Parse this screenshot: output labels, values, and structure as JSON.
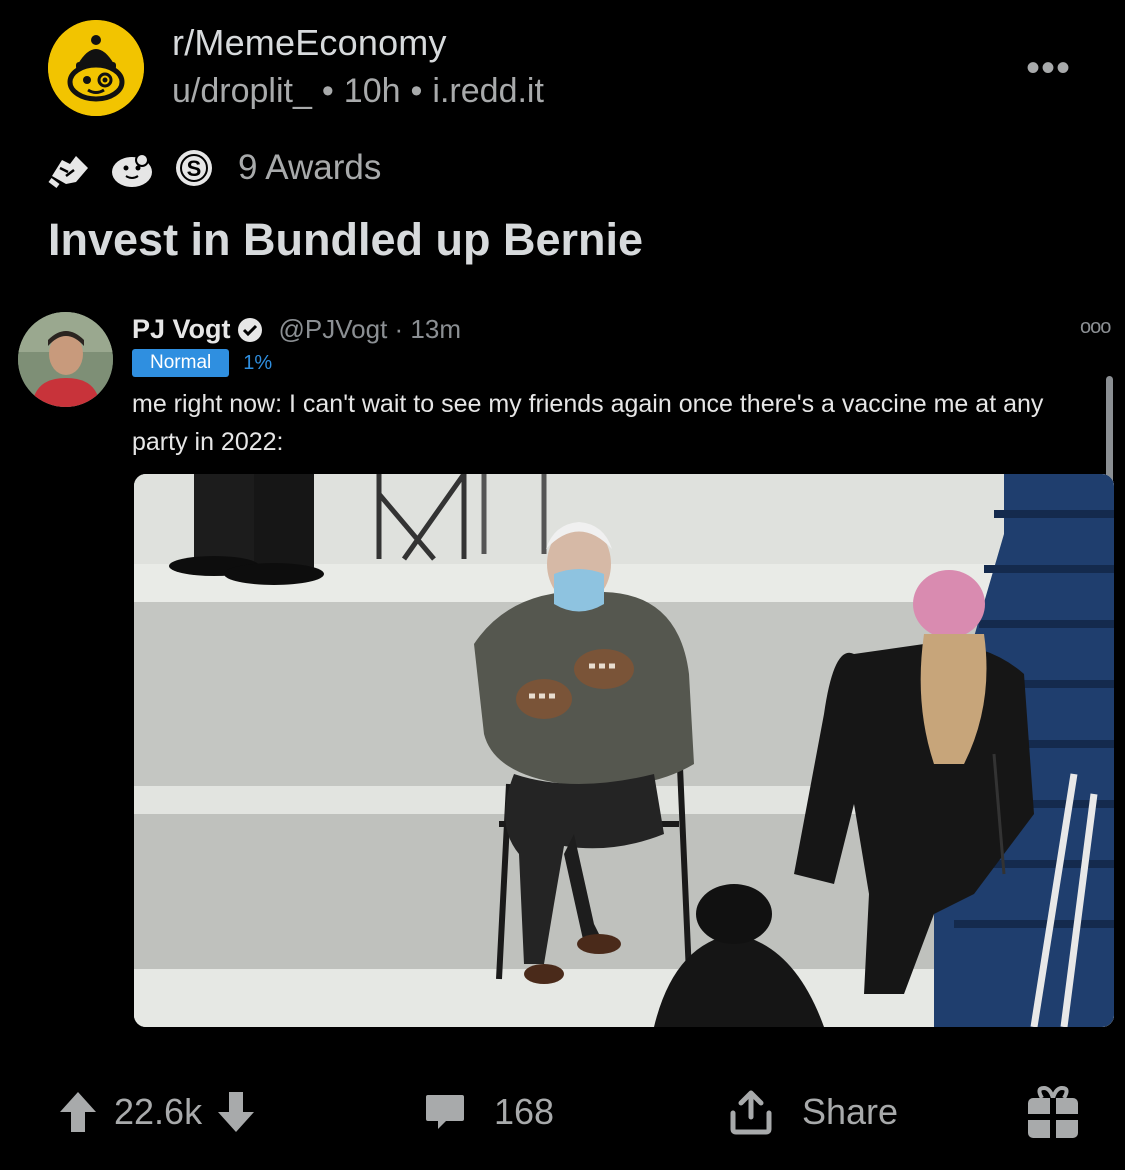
{
  "post": {
    "subreddit": "r/MemeEconomy",
    "author": "u/droplit_",
    "age": "10h",
    "domain": "i.redd.it",
    "separator": "•",
    "awards_label": "9 Awards",
    "title": "Invest in Bundled up Bernie",
    "more": "•••"
  },
  "tweet": {
    "name": "PJ Vogt",
    "handle_time": "@PJVogt · 13m",
    "badge": "Normal",
    "percent": "1%",
    "text": "me right now: I can't wait to see my friends again once there's a vaccine me at any party in 2022:",
    "more": "ooo"
  },
  "actions": {
    "score": "22.6k",
    "comments": "168",
    "share": "Share"
  },
  "icons": {
    "award_1": "handshake-award-icon",
    "award_2": "wholesome-seal-award-icon",
    "award_3": "silver-s-award-icon",
    "upvote": "upvote-arrow-icon",
    "downvote": "downvote-arrow-icon",
    "comment": "comment-bubble-icon",
    "share": "share-upload-icon",
    "gift": "gift-icon",
    "verified": "verified-check-icon"
  },
  "colors": {
    "background": "#000000",
    "text": "#d7dadc",
    "muted": "#a8aaab",
    "subreddit_avatar": "#f2c400",
    "twitter_blue": "#2f8fe0"
  }
}
